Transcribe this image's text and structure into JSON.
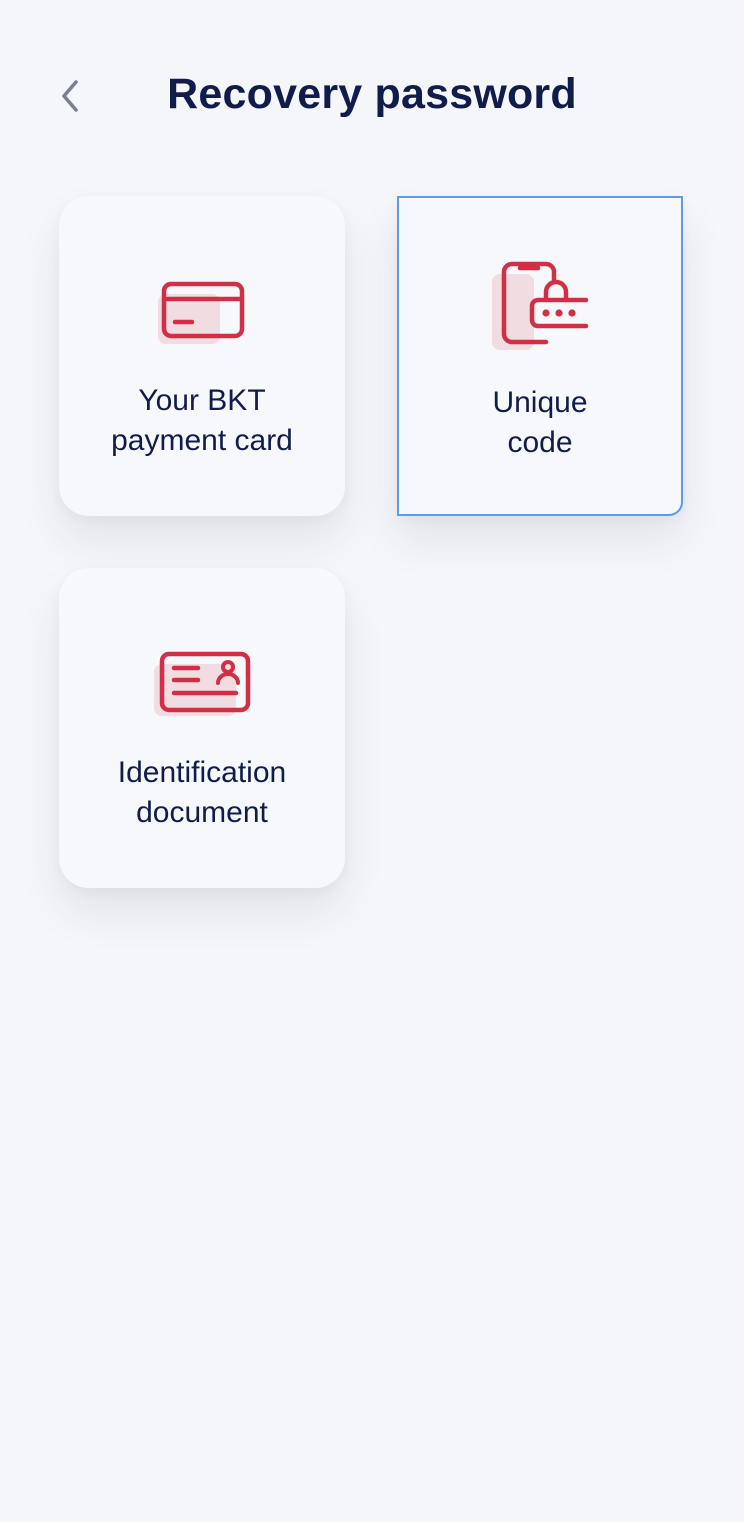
{
  "header": {
    "back_icon": "chevron-left-icon",
    "title": "Recovery password"
  },
  "options": [
    {
      "icon": "payment-card-icon",
      "line1": "Your BKT",
      "line2": "payment card",
      "selected": false
    },
    {
      "icon": "phone-lock-icon",
      "line1": "Unique",
      "line2": "code",
      "selected": true
    },
    {
      "icon": "id-document-icon",
      "line1": "Identification",
      "line2": "document",
      "selected": false
    }
  ],
  "colors": {
    "background": "#f5f6fa",
    "title": "#121c4a",
    "icon_accent": "#d12f45",
    "icon_fill": "#f1dce2",
    "selection_border": "#5b9be8",
    "back_chevron": "#7a7f98"
  }
}
